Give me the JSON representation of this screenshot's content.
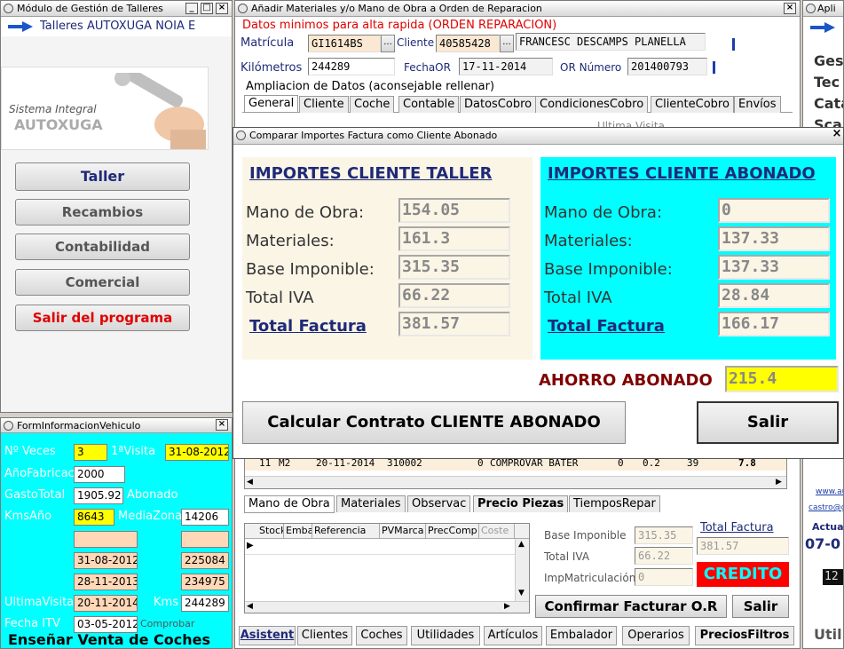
{
  "left_window": {
    "title": "Módulo de Gestión de Talleres",
    "company": "Talleres AUTOXUGA NOIA E",
    "logo_line1": "Sistema Integral",
    "logo_line2": "AUTOXUGA",
    "menu": [
      "Taller",
      "Recambios",
      "Contabilidad",
      "Comercial",
      "Salir del programa"
    ]
  },
  "vehicle_info": {
    "title": "FormInformacionVehiculo",
    "rows": {
      "veces_label": "Nº Veces",
      "veces": "3",
      "primera_label": "1ªVisita",
      "primera": "31-08-2012",
      "anio_label": "AñoFabricac",
      "anio": "2000",
      "gasto_label": "GastoTotal",
      "gasto": "1905.92",
      "abonado_label": "Abonado",
      "kmsanio_label": "KmsAño",
      "kmsanio": "8643",
      "mediazona_label": "MediaZona",
      "mediazona": "14206",
      "d1": "31-08-2012",
      "k1": "225084",
      "d2": "28-11-2013",
      "k2": "234975",
      "ultima_label": "UltimaVisita",
      "ultima": "20-11-2014",
      "kms_label": "Kms",
      "kms": "244289",
      "itv_label": "Fecha ITV",
      "itv": "03-05-2012",
      "comprobar": "Comprobar"
    },
    "footer": "Enseñar Venta de Coches"
  },
  "main_window": {
    "title": "Añadir Materiales y/o Mano de Obra a Orden de Reparacion",
    "header_red": "Datos minimos para alta rapida (ORDEN REPARACION)",
    "matricula_label": "Matrícula",
    "matricula": "GI1614BS",
    "cliente_label": "Cliente",
    "cliente": "40585428",
    "cliente_nombre": "FRANCESC DESCAMPS PLANELLA",
    "km_label": "Kilómetros",
    "km": "244289",
    "fecha_label": "FechaOR",
    "fecha": "17-11-2014",
    "or_label": "OR Número",
    "or_num": "201400793",
    "ampliacion": "Ampliacion de Datos (aconsejable rellenar)",
    "tabs": [
      "General",
      "Cliente",
      "Coche",
      "Contable",
      "DatosCobro",
      "CondicionesCobro",
      "ClienteCobro",
      "Envíos"
    ],
    "ultima_visita": "Ultima Visita",
    "row_text": [
      "11",
      "M2",
      "20-11-2014",
      "310002",
      "0",
      "COMPROVAR BATER",
      "0",
      "0.2",
      "39",
      "7.8"
    ],
    "tabs2": [
      "Mano de Obra",
      "Materiales",
      "Observac",
      "Precio Piezas",
      "TiemposRepar"
    ],
    "grid_headers": [
      "Stock",
      "Emba",
      "Referencia",
      "PVMarca",
      "PrecComp",
      "Coste"
    ],
    "base_label": "Base Imponible",
    "base": "315.35",
    "iva_label": "Total IVA",
    "iva": "66.22",
    "impmat_label": "ImpMatriculación",
    "impmat": "0",
    "total_label": "Total Factura",
    "total": "381.57",
    "credito": "CREDITO",
    "confirm_btn": "Confirmar Facturar O.R",
    "salir_btn": "Salir",
    "bottom_tabs": [
      "Asistent",
      "Clientes",
      "Coches",
      "Utilidades",
      "Artículos",
      "Embalador",
      "Operarios",
      "PreciosFiltros"
    ]
  },
  "right_window": {
    "title": "Apli",
    "items": [
      "Ges",
      "Tec",
      "Cata",
      "Sca"
    ],
    "link1": "www.aut",
    "link2": "castro@g",
    "actual": "Actua",
    "date": "07-0",
    "clock": "12",
    "util": "Util"
  },
  "dialog": {
    "title": "Comparar Importes Factura como Cliente Abonado",
    "taller": {
      "heading": "IMPORTES CLIENTE TALLER",
      "mano_label": "Mano de Obra:",
      "mano": "154.05",
      "mat_label": "Materiales:",
      "mat": "161.3",
      "base_label": "Base Imponible:",
      "base": "315.35",
      "iva_label": "Total IVA",
      "iva": "66.22",
      "total_label": "Total Factura",
      "total": "381.57"
    },
    "abonado": {
      "heading": "IMPORTES CLIENTE ABONADO",
      "mano_label": "Mano de Obra:",
      "mano": "0",
      "mat_label": "Materiales:",
      "mat": "137.33",
      "base_label": "Base Imponible:",
      "base": "137.33",
      "iva_label": "Total IVA",
      "iva": "28.84",
      "total_label": "Total Factura",
      "total": "166.17"
    },
    "ahorro_label": "AHORRO ABONADO",
    "ahorro": "215.4",
    "calc_btn": "Calcular Contrato CLIENTE ABONADO",
    "salir_btn": "Salir"
  },
  "colors": {
    "cyan": "#00ffff",
    "yellow": "#ffff00",
    "peach": "#ffd8b8",
    "red": "#ff0000",
    "navy": "#1e2a78",
    "maroon": "#800000"
  }
}
